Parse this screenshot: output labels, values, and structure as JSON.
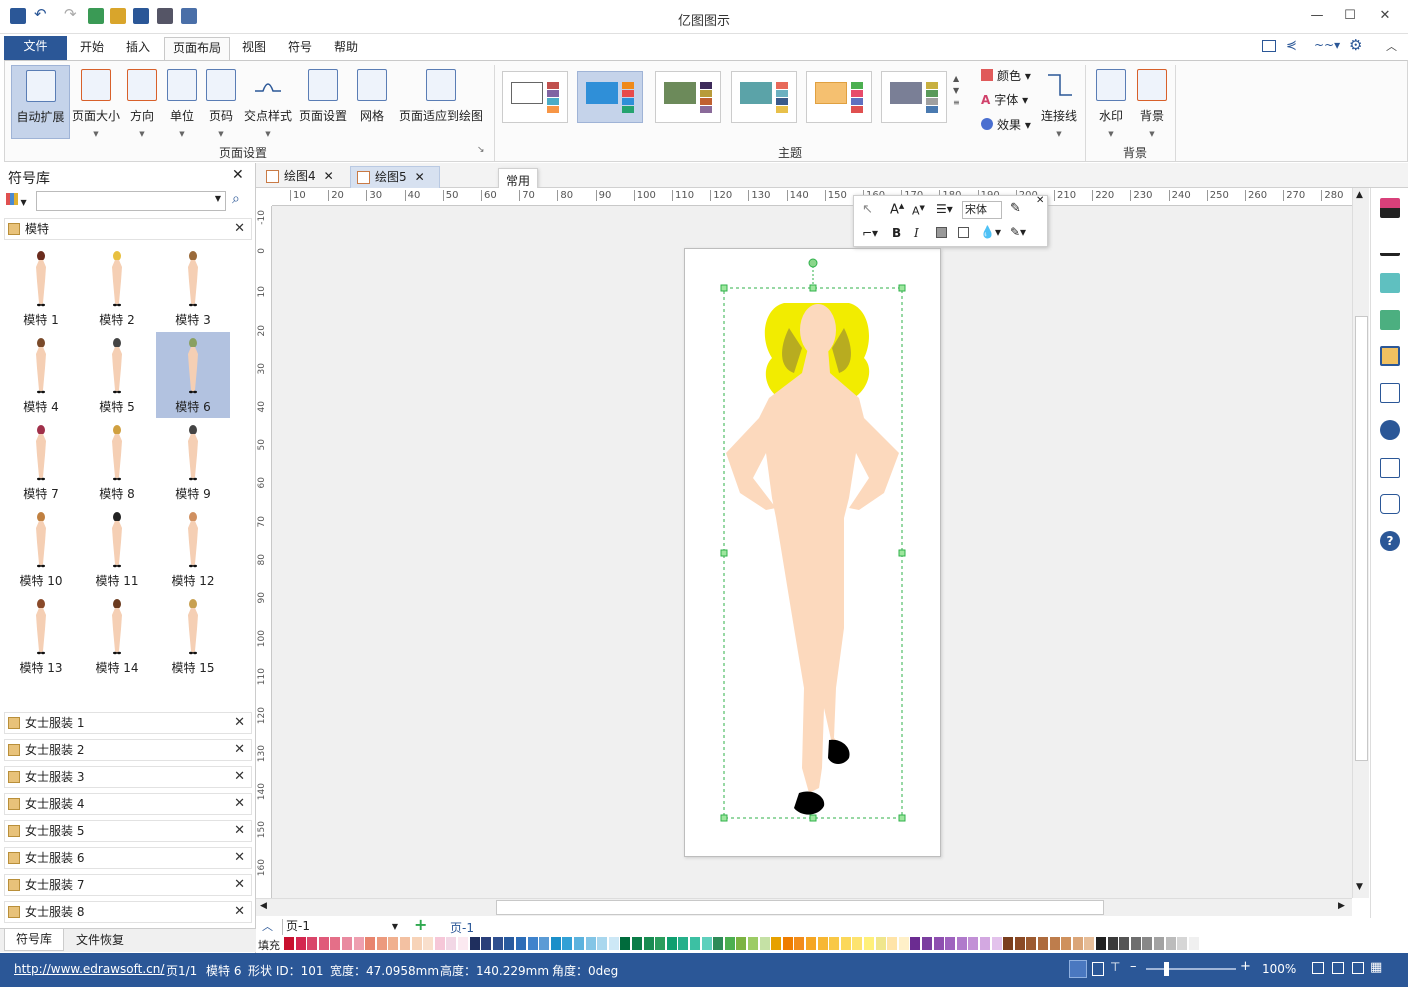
{
  "app": {
    "title": "亿图图示"
  },
  "menu": {
    "file": "文件",
    "tabs": [
      "开始",
      "插入",
      "页面布局",
      "视图",
      "符号",
      "帮助"
    ],
    "active": "页面布局"
  },
  "ribbon": {
    "page_setup": {
      "group_label": "页面设置",
      "buttons": [
        "自动扩展",
        "页面大小",
        "方向",
        "单位",
        "页码",
        "交点样式",
        "页面设置",
        "网格",
        "页面适应到绘图"
      ]
    },
    "theme": {
      "group_label": "主题",
      "color": "颜色",
      "font": "字体",
      "effect": "效果",
      "connector": "连接线"
    },
    "background": {
      "group_label": "背景",
      "watermark": "水印",
      "background": "背景"
    }
  },
  "library": {
    "title": "符号库",
    "search_placeholder": "",
    "open_group": "模特",
    "shapes": [
      "模特 1",
      "模特 2",
      "模特 3",
      "模特 4",
      "模特 5",
      "模特 6",
      "模特 7",
      "模特 8",
      "模特 9",
      "模特 10",
      "模特 11",
      "模特 12",
      "模特 13",
      "模特 14",
      "模特 15"
    ],
    "selected_shape": "模特 6",
    "collapsed_groups": [
      "女士服装 1",
      "女士服装 2",
      "女士服装 3",
      "女士服装 4",
      "女士服装 5",
      "女士服装 6",
      "女士服装 7",
      "女士服装 8"
    ],
    "bottom_tabs": [
      "符号库",
      "文件恢复"
    ]
  },
  "documents": {
    "tabs": [
      "绘图4",
      "绘图5"
    ],
    "active": "绘图5"
  },
  "tooltip": "常用",
  "hruler": [
    "10",
    "20",
    "30",
    "40",
    "50",
    "60",
    "70",
    "80",
    "90",
    "100",
    "110",
    "120",
    "130",
    "140",
    "150",
    "160",
    "170",
    "180",
    "190",
    "200",
    "210",
    "220",
    "230",
    "240",
    "250",
    "260",
    "270",
    "280"
  ],
  "vruler": [
    "-10",
    "0",
    "10",
    "20",
    "30",
    "40",
    "50",
    "60",
    "70",
    "80",
    "90",
    "100",
    "110",
    "120",
    "130",
    "140",
    "150",
    "160"
  ],
  "minitool": {
    "font_value": "宋体"
  },
  "pages": {
    "current": "页-1",
    "tab": "页-1"
  },
  "palette": {
    "label": "填充",
    "colors": [
      "#c8102e",
      "#d4264f",
      "#d9466a",
      "#e05a7a",
      "#e46f88",
      "#e98aa0",
      "#ee9fb0",
      "#e8846e",
      "#ec9a7e",
      "#f0b08f",
      "#f3c1a2",
      "#f7d3b8",
      "#f9dfcc",
      "#f6c7d8",
      "#f2d7e5",
      "#fbe9f0",
      "#1f2f5e",
      "#2a3f7a",
      "#2f4f8f",
      "#285a9e",
      "#2c6db8",
      "#3f83cc",
      "#5b9bd5",
      "#1b8fc9",
      "#32a1d6",
      "#5cb3de",
      "#83c5e6",
      "#a9d7ee",
      "#cde8f6",
      "#006b3c",
      "#0b7d48",
      "#188c52",
      "#2a9d5c",
      "#0f9f6f",
      "#26b08a",
      "#3cc0a3",
      "#5fd0bd",
      "#2e8b57",
      "#4caf50",
      "#7cb342",
      "#9ccc65",
      "#c5e1a5",
      "#e6a100",
      "#ef7d00",
      "#f28c1a",
      "#f5a623",
      "#f7b733",
      "#f9c846",
      "#fbd85a",
      "#fde36f",
      "#fff07a",
      "#f0e68c",
      "#ffe4a8",
      "#fff0c8",
      "#6b2c91",
      "#7b3fa0",
      "#8e4fb0",
      "#9e62be",
      "#b07acb",
      "#c290d6",
      "#d3a8e1",
      "#e3c2ec",
      "#7a3e1d",
      "#8b4a25",
      "#9c5a30",
      "#ad6b3d",
      "#be7d4c",
      "#cf915d",
      "#dba679",
      "#e6bd98",
      "#202020",
      "#3a3a3a",
      "#545454",
      "#6e6e6e",
      "#888888",
      "#a2a2a2",
      "#bcbcbc",
      "#d6d6d6",
      "#f0f0f0"
    ]
  },
  "status": {
    "url": "http://www.edrawsoft.cn/",
    "page": "页1/1",
    "shape": "模特 6",
    "shape_id": "形状 ID：101",
    "width": "宽度：47.0958mm",
    "height": "高度：140.229mm",
    "angle": "角度：0deg",
    "zoom": "100%"
  }
}
